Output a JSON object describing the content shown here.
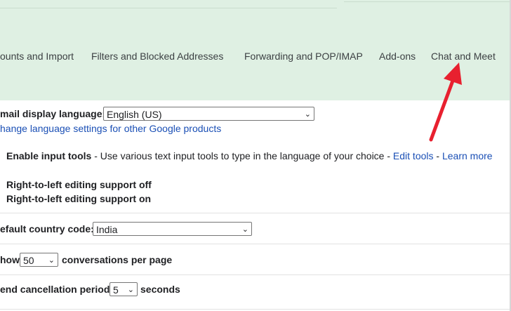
{
  "tabs": [
    {
      "label": "ounts and Import"
    },
    {
      "label": "Filters and Blocked Addresses"
    },
    {
      "label": "Forwarding and POP/IMAP"
    },
    {
      "label": "Add-ons"
    },
    {
      "label": "Chat and Meet"
    }
  ],
  "language": {
    "label": "mail display language:",
    "value": "English (US)",
    "change_link": "hange language settings for other Google products"
  },
  "input_tools": {
    "label": "Enable input tools",
    "description": " - Use various text input tools to type in the language of your choice - ",
    "edit_link": "Edit tools",
    "separator": " - ",
    "learn_link": "Learn more"
  },
  "rtl": {
    "off": "Right-to-left editing support off",
    "on": "Right-to-left editing support on"
  },
  "country": {
    "label": "efault country code:",
    "value": "India"
  },
  "page_size": {
    "prefix": "how",
    "value": "50",
    "suffix": "conversations per page"
  },
  "undo_send": {
    "label": "end cancellation period:",
    "value": "5",
    "suffix": "seconds"
  },
  "colors": {
    "header_bg": "#dff0e3",
    "link": "#1a4fb5",
    "arrow": "#e8202f"
  }
}
